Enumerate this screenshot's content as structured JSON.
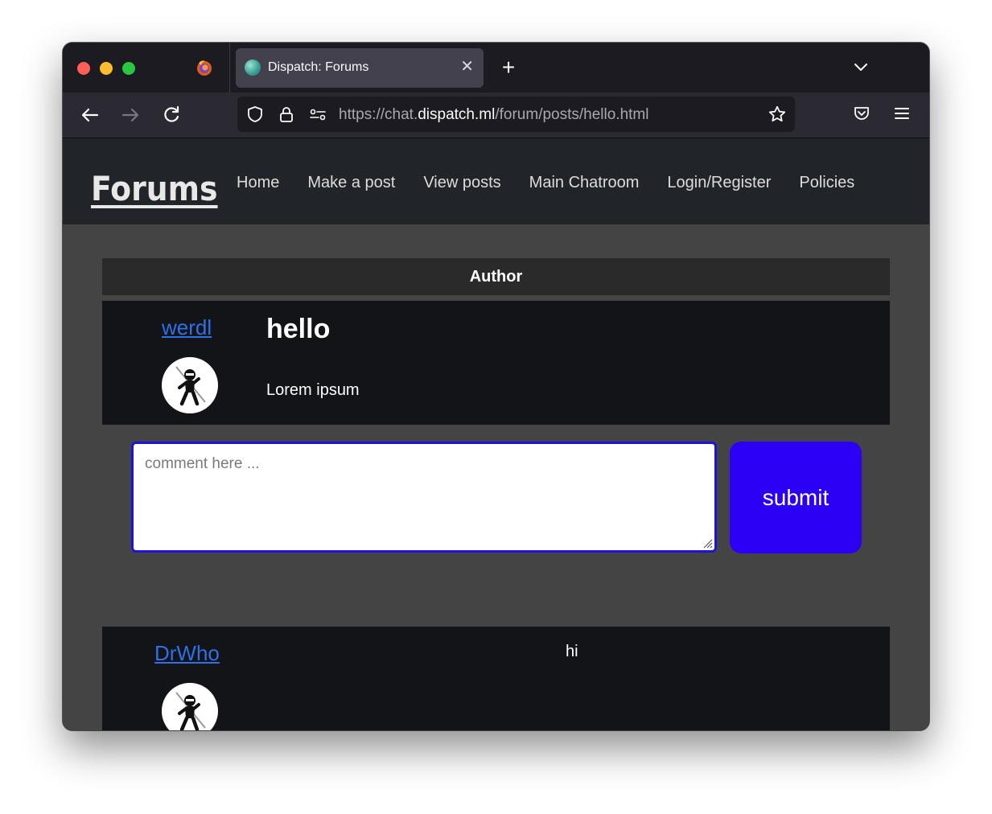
{
  "browser": {
    "tab_title": "Dispatch: Forums",
    "tab_close": "✕",
    "new_tab": "+",
    "url_prefix": "https://chat.",
    "url_host": "dispatch.ml",
    "url_path": "/forum/posts/hello.html"
  },
  "site": {
    "brand": "Forums",
    "nav": [
      "Home",
      "Make a post",
      "View posts",
      "Main Chatroom",
      "Login/Register",
      "Policies"
    ]
  },
  "thread": {
    "author_header": "Author",
    "post": {
      "author": "werdl",
      "title": "hello",
      "body": "Lorem ipsum"
    },
    "comment_form": {
      "placeholder": "comment here ...",
      "submit_label": "submit"
    },
    "comments": [
      {
        "author": "DrWho",
        "text": "hi"
      }
    ]
  },
  "colors": {
    "link": "#2f6fe8",
    "submit_bg": "#2b00f5",
    "page_bg": "#444444",
    "header_bg": "#212529",
    "card_bg": "#131417"
  }
}
